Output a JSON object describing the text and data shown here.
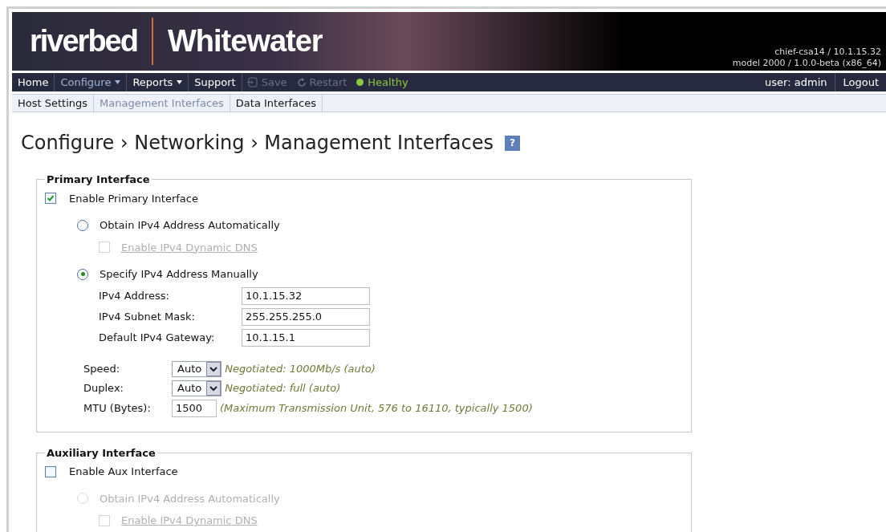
{
  "header": {
    "brand": "riverbed",
    "product": "Whitewater",
    "host": "chief-csa14 / 10.1.15.32",
    "model": "model 2000 / 1.0.0-beta (x86_64)"
  },
  "nav": {
    "items": [
      {
        "label": "Home",
        "kind": "menu",
        "dropdown": false,
        "selected": false
      },
      {
        "label": "Configure",
        "kind": "menu",
        "dropdown": true,
        "selected": true
      },
      {
        "label": "Reports",
        "kind": "menu",
        "dropdown": true,
        "selected": false
      },
      {
        "label": "Support",
        "kind": "menu",
        "dropdown": false,
        "selected": false
      },
      {
        "label": "Save",
        "kind": "save",
        "disabled": true
      },
      {
        "label": "Restart",
        "kind": "restart",
        "disabled": true
      },
      {
        "label": "Healthy",
        "kind": "status",
        "color": "#8dc63f"
      }
    ],
    "user": "user: admin",
    "logout": "Logout"
  },
  "subtabs": [
    {
      "label": "Host Settings",
      "selected": false
    },
    {
      "label": "Management Interfaces",
      "selected": true
    },
    {
      "label": "Data Interfaces",
      "selected": false
    }
  ],
  "title": "Configure › Networking › Management Interfaces",
  "help": "?",
  "sections": [
    {
      "legend": "Primary Interface",
      "enable": {
        "label": "Enable Primary Interface",
        "checked": true
      },
      "modes": [
        {
          "label": "Obtain IPv4 Address Automatically",
          "selected": false,
          "disabled": false,
          "dns": {
            "label": "Enable IPv4 Dynamic DNS",
            "checked": false,
            "disabled": true
          }
        },
        {
          "label": "Specify IPv4 Address Manually",
          "selected": true,
          "disabled": false,
          "fields": [
            {
              "label": "IPv4 Address:",
              "value": "10.1.15.32"
            },
            {
              "label": "IPv4 Subnet Mask:",
              "value": "255.255.255.0"
            },
            {
              "label": "Default IPv4 Gateway:",
              "value": "10.1.15.1"
            }
          ]
        }
      ],
      "settings": [
        {
          "kind": "select",
          "label": "Speed:",
          "value": "Auto",
          "note": "Negotiated: 1000Mb/s (auto)"
        },
        {
          "kind": "select",
          "label": "Duplex:",
          "value": "Auto",
          "note": "Negotiated: full (auto)"
        },
        {
          "kind": "input",
          "label": "MTU (Bytes):",
          "value": "1500",
          "note": "(Maximum Transmission Unit, 576 to 16110, typically 1500)"
        }
      ]
    },
    {
      "legend": "Auxiliary Interface",
      "enable": {
        "label": "Enable Aux Interface",
        "checked": false
      },
      "modes": [
        {
          "label": "Obtain IPv4 Address Automatically",
          "selected": false,
          "disabled": true,
          "dns": {
            "label": "Enable IPv4 Dynamic DNS",
            "checked": false,
            "disabled": true
          }
        }
      ]
    }
  ]
}
